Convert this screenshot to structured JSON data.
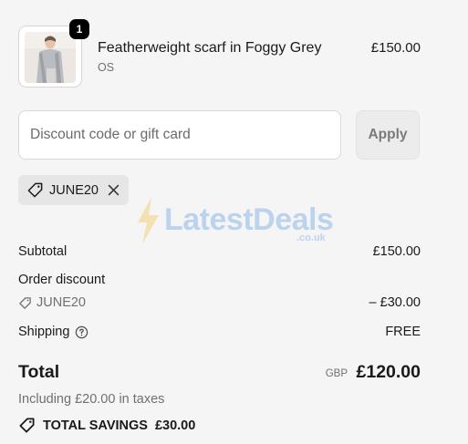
{
  "product": {
    "quantity": "1",
    "name": "Featherweight scarf in Foggy Grey",
    "variant": "OS",
    "price": "£150.00"
  },
  "discount": {
    "placeholder": "Discount code or gift card",
    "value": "",
    "apply_label": "Apply",
    "applied_code": "JUNE20"
  },
  "watermark": {
    "brand": "LatestDeals",
    "domain": ".co.uk"
  },
  "summary": {
    "subtotal_label": "Subtotal",
    "subtotal_value": "£150.00",
    "order_discount_label": "Order discount",
    "discount_code": "JUNE20",
    "discount_value": "– £30.00",
    "shipping_label": "Shipping",
    "shipping_value": "FREE",
    "total_label": "Total",
    "currency": "GBP",
    "total_value": "£120.00",
    "tax_note": "Including £20.00 in taxes",
    "savings_label": "TOTAL SAVINGS",
    "savings_value": "£30.00"
  },
  "icons": {
    "tag": "tag-icon",
    "close": "close-icon",
    "help": "help-circle-icon",
    "savings_tag": "tag-icon"
  },
  "colors": {
    "background": "#f5f5f5",
    "badge": "#000000",
    "watermark": "#2b7fd9"
  }
}
